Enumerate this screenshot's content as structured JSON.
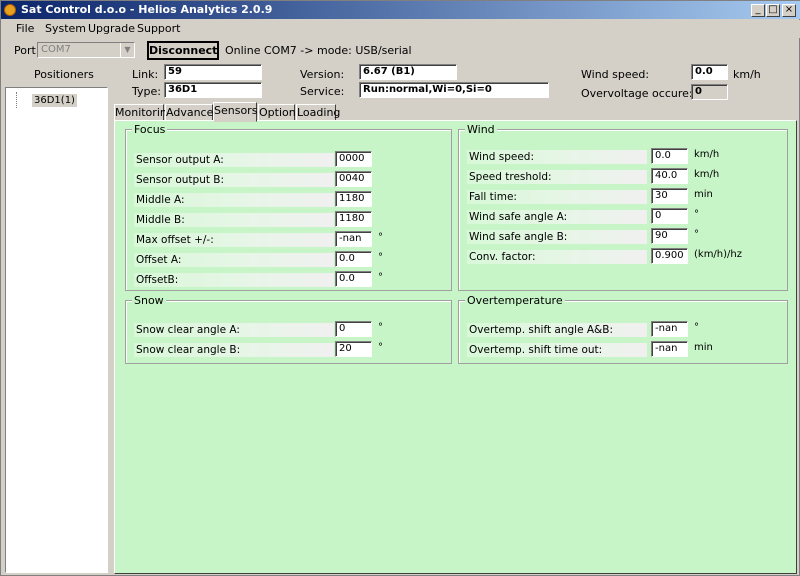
{
  "window": {
    "title": "Sat Control d.o.o - Helios Analytics 2.0.9"
  },
  "menu": [
    "File",
    "System",
    "Upgrade",
    "Support"
  ],
  "port": {
    "label": "Port:",
    "value": "COM7",
    "button": "Disconnect",
    "status": "Online COM7 -> mode: USB/serial"
  },
  "positioners": {
    "header": "Positioners",
    "items": [
      "36D1(1)"
    ]
  },
  "info": {
    "link_label": "Link:",
    "link": "59",
    "type_label": "Type:",
    "type": "36D1",
    "version_label": "Version:",
    "version": "6.67 (B1)",
    "service_label": "Service:",
    "service": "Run:normal,Wi=0,Si=0",
    "wind_label": "Wind speed:",
    "wind": "0.0",
    "wind_unit": "km/h",
    "overvoltage_label": "Overvoltage occure:",
    "overvoltage": "0"
  },
  "tabs": [
    "Monitoring",
    "Advanced",
    "Sensors",
    "Options",
    "Loading"
  ],
  "active_tab": "Sensors",
  "focus": {
    "title": "Focus",
    "rows": [
      {
        "label": "Sensor output A:",
        "value": "0000",
        "unit": ""
      },
      {
        "label": "Sensor output B:",
        "value": "0040",
        "unit": ""
      },
      {
        "label": "Middle A:",
        "value": "1180",
        "unit": ""
      },
      {
        "label": "Middle B:",
        "value": "1180",
        "unit": ""
      },
      {
        "label": "Max offset +/-:",
        "value": "-nan",
        "unit": "°"
      },
      {
        "label": "Offset A:",
        "value": "0.0",
        "unit": "°"
      },
      {
        "label": "OffsetB:",
        "value": "0.0",
        "unit": "°"
      }
    ]
  },
  "wind": {
    "title": "Wind",
    "rows": [
      {
        "label": "Wind speed:",
        "value": "0.0",
        "unit": "km/h"
      },
      {
        "label": "Speed treshold:",
        "value": "40.0",
        "unit": "km/h"
      },
      {
        "label": "Fall time:",
        "value": "30",
        "unit": "min"
      },
      {
        "label": "Wind safe angle A:",
        "value": "0",
        "unit": "°"
      },
      {
        "label": "Wind safe angle B:",
        "value": "90",
        "unit": "°"
      },
      {
        "label": "Conv. factor:",
        "value": "0.900",
        "unit": "(km/h)/hz"
      }
    ]
  },
  "snow": {
    "title": "Snow",
    "rows": [
      {
        "label": "Snow clear angle A:",
        "value": "0",
        "unit": "°"
      },
      {
        "label": "Snow clear angle B:",
        "value": "20",
        "unit": "°"
      }
    ]
  },
  "overtemp": {
    "title": "Overtemperature",
    "rows": [
      {
        "label": "Overtemp. shift angle A&B:",
        "value": "-nan",
        "unit": "°"
      },
      {
        "label": "Overtemp. shift time out:",
        "value": "-nan",
        "unit": "min"
      }
    ]
  }
}
